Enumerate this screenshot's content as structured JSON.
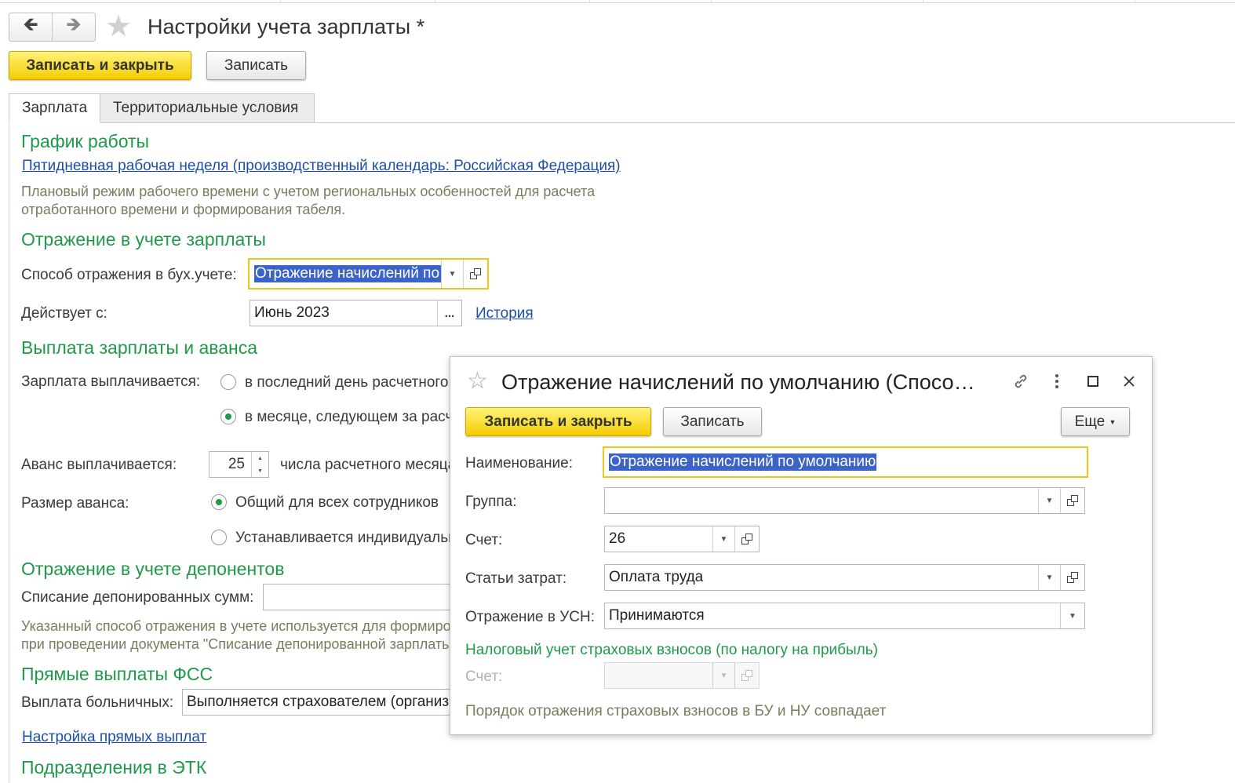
{
  "nav": {
    "back_icon": "arrow-left-icon",
    "forward_icon": "arrow-right-icon",
    "star_icon": "star-icon"
  },
  "main": {
    "title": "Настройки учета зарплаты *",
    "save_close_label": "Записать и закрыть",
    "save_label": "Записать",
    "tabs": [
      {
        "label": "Зарплата"
      },
      {
        "label": "Территориальные условия"
      }
    ]
  },
  "schedule": {
    "heading": "График работы",
    "link": "Пятидневная рабочая неделя (производственный календарь: Российская Федерация)",
    "note_line1": "Плановый режим рабочего времени с учетом региональных особенностей для расчета",
    "note_line2": "отработанного времени и формирования табеля."
  },
  "reflection": {
    "heading": "Отражение в учете зарплаты",
    "method_label": "Способ отражения в бух.учете:",
    "method_value": "Отражение начислений по умолчанию",
    "effective_label": "Действует с:",
    "effective_value": "Июнь 2023",
    "history_link": "История"
  },
  "payment": {
    "heading": "Выплата зарплаты и аванса",
    "salary_label": "Зарплата выплачивается:",
    "salary_opt1": "в последний день расчетного месяца",
    "salary_opt2": "в месяце, следующем за расчетным",
    "salary_selected": 2,
    "advance_label": "Аванс выплачивается:",
    "advance_value": "25",
    "advance_suffix": "числа расчетного месяца",
    "size_label": "Размер аванса:",
    "size_opt1": "Общий для всех сотрудников",
    "size_opt2": "Устанавливается индивидуально",
    "size_selected": 1
  },
  "deponents": {
    "heading": "Отражение в учете депонентов",
    "writeoff_label": "Списание депонированных сумм:",
    "writeoff_value": "",
    "note_line1": "Указанный способ отражения в учете используется для формирования проводок",
    "note_line2": "при проведении документа \"Списание депонированной зарплаты\""
  },
  "fss": {
    "heading": "Прямые выплаты ФСС",
    "sick_label": "Выплата больничных:",
    "sick_value": "Выполняется страхователем (организацией)",
    "settings_link": "Настройка прямых выплат"
  },
  "etk": {
    "heading": "Подразделения в ЭТК"
  },
  "popup": {
    "title": "Отражение начислений по умолчанию (Спосо…",
    "link_icon": "link-icon",
    "more_icon": "vertical-dots-icon",
    "maximize_icon": "maximize-icon",
    "close_icon": "close-icon",
    "save_close_label": "Записать и закрыть",
    "save_label": "Записать",
    "more_label": "Еще",
    "name_label": "Наименование:",
    "name_value": "Отражение начислений по умолчанию",
    "group_label": "Группа:",
    "group_value": "",
    "account_label": "Счет:",
    "account_value": "26",
    "costs_label": "Статьи затрат:",
    "costs_value": "Оплата труда",
    "usn_label": "Отражение в УСН:",
    "usn_value": "Принимаются",
    "tax_heading": "Налоговый учет страховых взносов (по налогу на прибыль)",
    "tax_account_label": "Счет:",
    "tax_account_value": "",
    "footer_note": "Порядок отражения страховых взносов в БУ и НУ совпадает"
  },
  "colors": {
    "accent_green": "#1e9a49",
    "link_blue": "#1d4fa8",
    "button_yellow": "#f3cd00",
    "focus_border": "#f0c419",
    "selection": "#3c64c8"
  }
}
